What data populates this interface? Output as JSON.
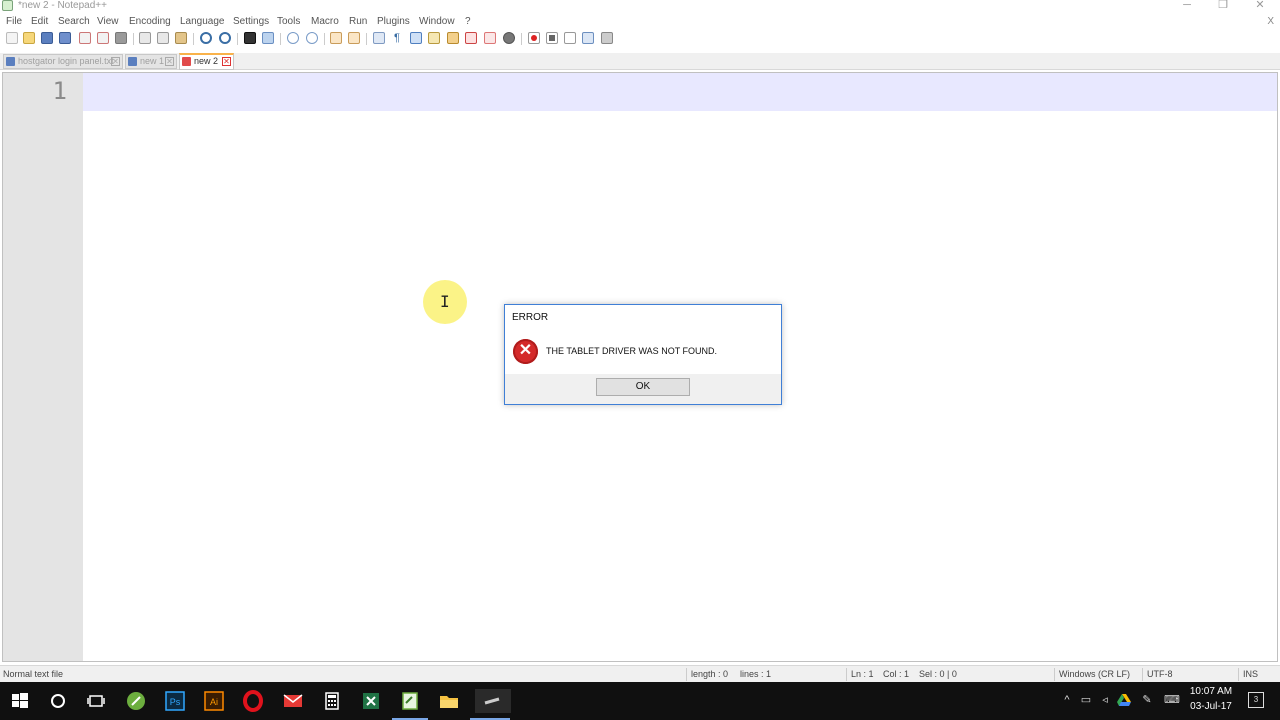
{
  "window": {
    "title": "*new 2 - Notepad++",
    "minimize_glyph": "─",
    "restore_glyph": "❐",
    "close_glyph": "✕"
  },
  "menu": {
    "items": [
      "File",
      "Edit",
      "Search",
      "View",
      "Encoding",
      "Language",
      "Settings",
      "Tools",
      "Macro",
      "Run",
      "Plugins",
      "Window",
      "?"
    ],
    "close_glyph": "X"
  },
  "tabs": [
    {
      "label": "hostgator login panel.txt",
      "state": "inactive",
      "icon": "saved-file-icon"
    },
    {
      "label": "new 1",
      "state": "inactive",
      "icon": "saved-file-icon"
    },
    {
      "label": "new 2",
      "state": "active",
      "icon": "unsaved-file-icon"
    }
  ],
  "editor": {
    "line_number": "1",
    "current_line_color": "#e8e8ff"
  },
  "dialog": {
    "title": "ERROR",
    "message": "THE TABLET DRIVER WAS NOT FOUND.",
    "ok_label": "OK",
    "icon": "error-icon",
    "icon_glyph": "✕"
  },
  "status": {
    "file_type": "Normal text file",
    "length": "length : 0",
    "lines": "lines : 1",
    "ln": "Ln : 1",
    "col": "Col : 1",
    "sel": "Sel : 0 | 0",
    "eol": "Windows (CR LF)",
    "encoding": "UTF-8",
    "mode": "INS"
  },
  "taskbar": {
    "time": "10:07 AM",
    "date": "03-Jul-17",
    "notifications": "3"
  },
  "colors": {
    "accent_tab": "#f9b24a",
    "dialog_border": "#3f7fd6",
    "error_red": "#d42a2a",
    "taskbar": "#101010"
  }
}
